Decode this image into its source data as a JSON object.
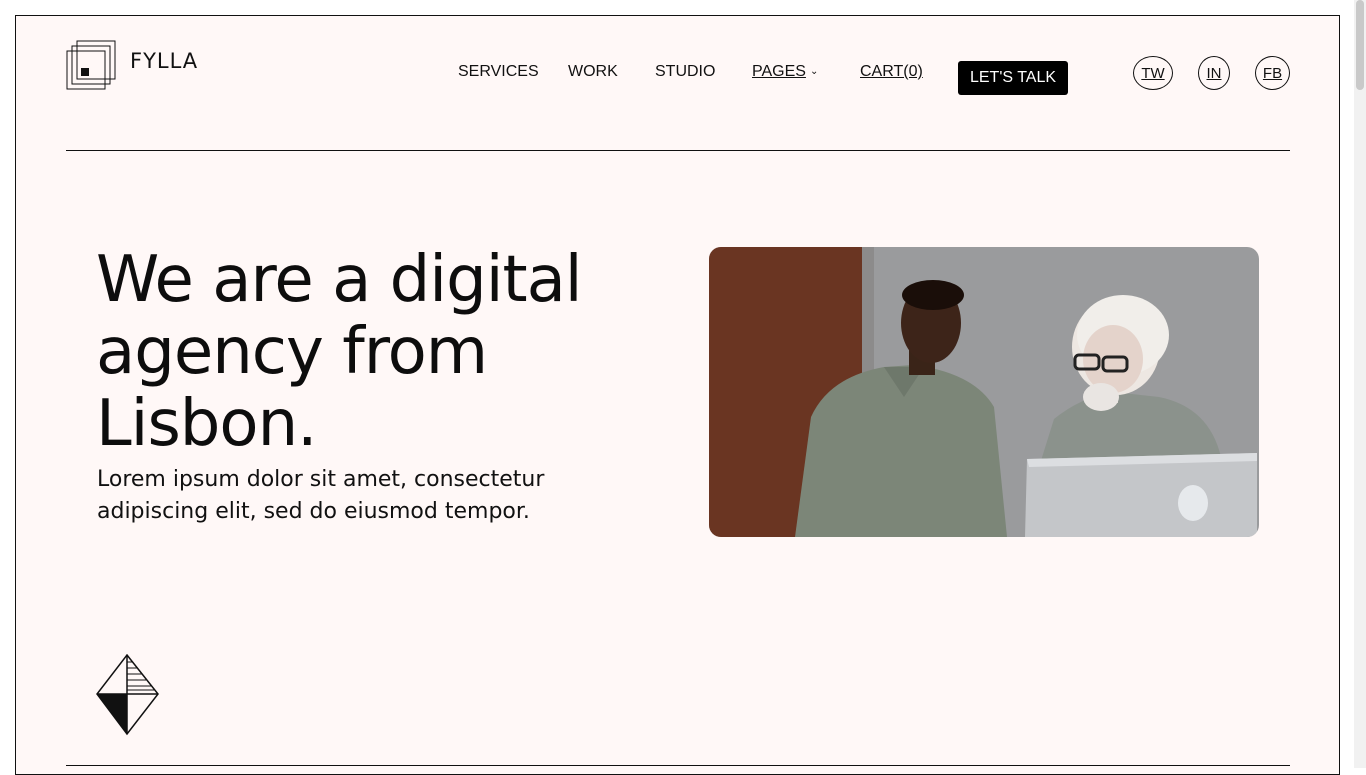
{
  "brand": {
    "name": "FYLLA",
    "logo_icon": "stacked-squares-icon"
  },
  "nav": {
    "items": [
      {
        "label": "SERVICES"
      },
      {
        "label": "WORK"
      },
      {
        "label": "STUDIO"
      },
      {
        "label": "PAGES",
        "has_dropdown": true,
        "icon": "chevron-down-icon"
      },
      {
        "label": "CART(0)"
      }
    ],
    "cta": "LET'S TALK"
  },
  "social": [
    {
      "label": "TW"
    },
    {
      "label": "IN"
    },
    {
      "label": "FB"
    }
  ],
  "hero": {
    "headline_lines": [
      "We are a digital",
      "agency from",
      "Lisbon."
    ],
    "subtext_lines": [
      "Lorem ipsum dolor sit amet, consectetur",
      "adipiscing elit, sed do eiusmod tempor."
    ],
    "image": "two-men-at-laptop-photo"
  },
  "emblem_icon": "diamond-emblem-icon",
  "colors": {
    "background": "#fff8f7",
    "text": "#111111",
    "button_bg": "#000000",
    "button_text": "#ffffff"
  }
}
